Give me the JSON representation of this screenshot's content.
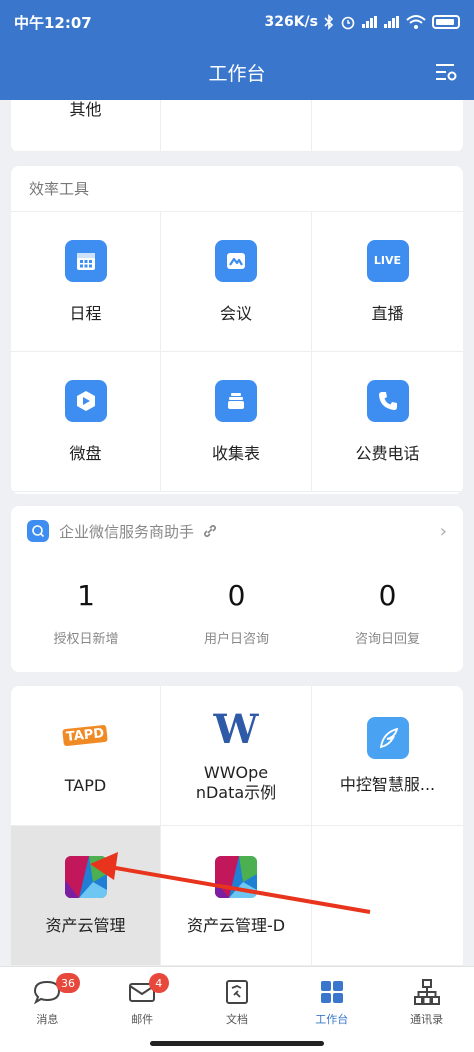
{
  "status_bar": {
    "time": "中午12:07",
    "speed": "326K/s"
  },
  "header": {
    "title": "工作台"
  },
  "top_partial": {
    "label": "其他"
  },
  "efficiency": {
    "title": "效率工具",
    "items": [
      {
        "label": "日程",
        "icon": "calendar-icon"
      },
      {
        "label": "会议",
        "icon": "meeting-icon"
      },
      {
        "label": "直播",
        "icon": "live-icon",
        "badge_text": "LIVE"
      },
      {
        "label": "微盘",
        "icon": "drive-icon"
      },
      {
        "label": "收集表",
        "icon": "form-icon"
      },
      {
        "label": "公费电话",
        "icon": "phone-icon"
      }
    ]
  },
  "helper": {
    "title": "企业微信服务商助手",
    "stats": [
      {
        "value": "1",
        "label": "授权日新增"
      },
      {
        "value": "0",
        "label": "用户日咨询"
      },
      {
        "value": "0",
        "label": "咨询日回复"
      }
    ]
  },
  "apps": {
    "items": [
      {
        "line1": "TAPD",
        "line2": ""
      },
      {
        "line1": "WWOpe",
        "line2": "nData示例"
      },
      {
        "line1": "中控智慧服...",
        "line2": ""
      },
      {
        "line1": "资产云管理",
        "line2": ""
      },
      {
        "line1": "资产云管理-D",
        "line2": ""
      }
    ],
    "tapd_logo_text": "TAPD",
    "ww_logo_text": "W"
  },
  "nav": {
    "items": [
      {
        "label": "消息",
        "badge": "36"
      },
      {
        "label": "邮件",
        "badge": "4"
      },
      {
        "label": "文档",
        "badge": ""
      },
      {
        "label": "工作台",
        "badge": ""
      },
      {
        "label": "通讯录",
        "badge": ""
      }
    ]
  },
  "colors": {
    "brand": "#3a77cc",
    "icon_blue": "#3d8ef0",
    "badge_red": "#e8473c",
    "arrow": "#e8341c"
  }
}
